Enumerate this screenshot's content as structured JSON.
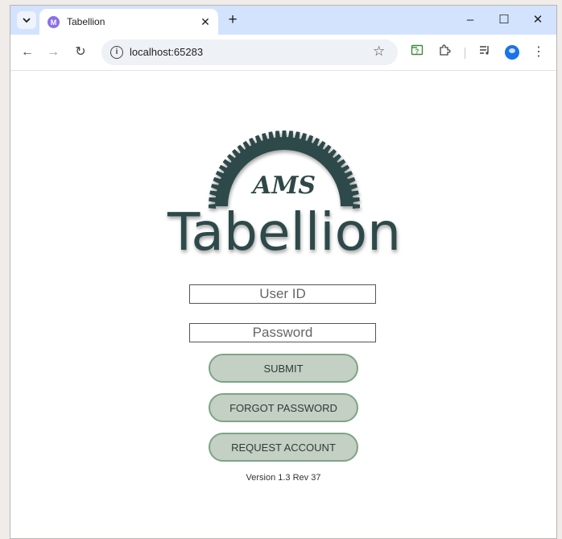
{
  "browser": {
    "tab_title": "Tabellion",
    "tab_close": "✕",
    "new_tab": "+",
    "url": "localhost:65283",
    "controls": {
      "minimize": "–",
      "maximize": "☐",
      "close": "✕"
    },
    "nav": {
      "back": "←",
      "forward": "→",
      "reload": "↻"
    },
    "icons": [
      "tab-search-icon",
      "favicon-icon",
      "info-icon",
      "star-icon",
      "extension-question-icon",
      "puzzle-icon",
      "media-icon",
      "profile-icon",
      "menu-icon"
    ]
  },
  "logo": {
    "top_text": "AMS",
    "main_text": "Tabellion",
    "color": "#2f4848"
  },
  "login": {
    "user_placeholder": "User ID",
    "password_placeholder": "Password",
    "submit_label": "SUBMIT",
    "forgot_label": "FORGOT PASSWORD",
    "request_label": "REQUEST ACCOUNT",
    "version": "Version 1.3 Rev 37"
  },
  "colors": {
    "button_fill": "#c4d0c3",
    "button_border": "#7da486",
    "tabbar": "#d3e3fd"
  }
}
